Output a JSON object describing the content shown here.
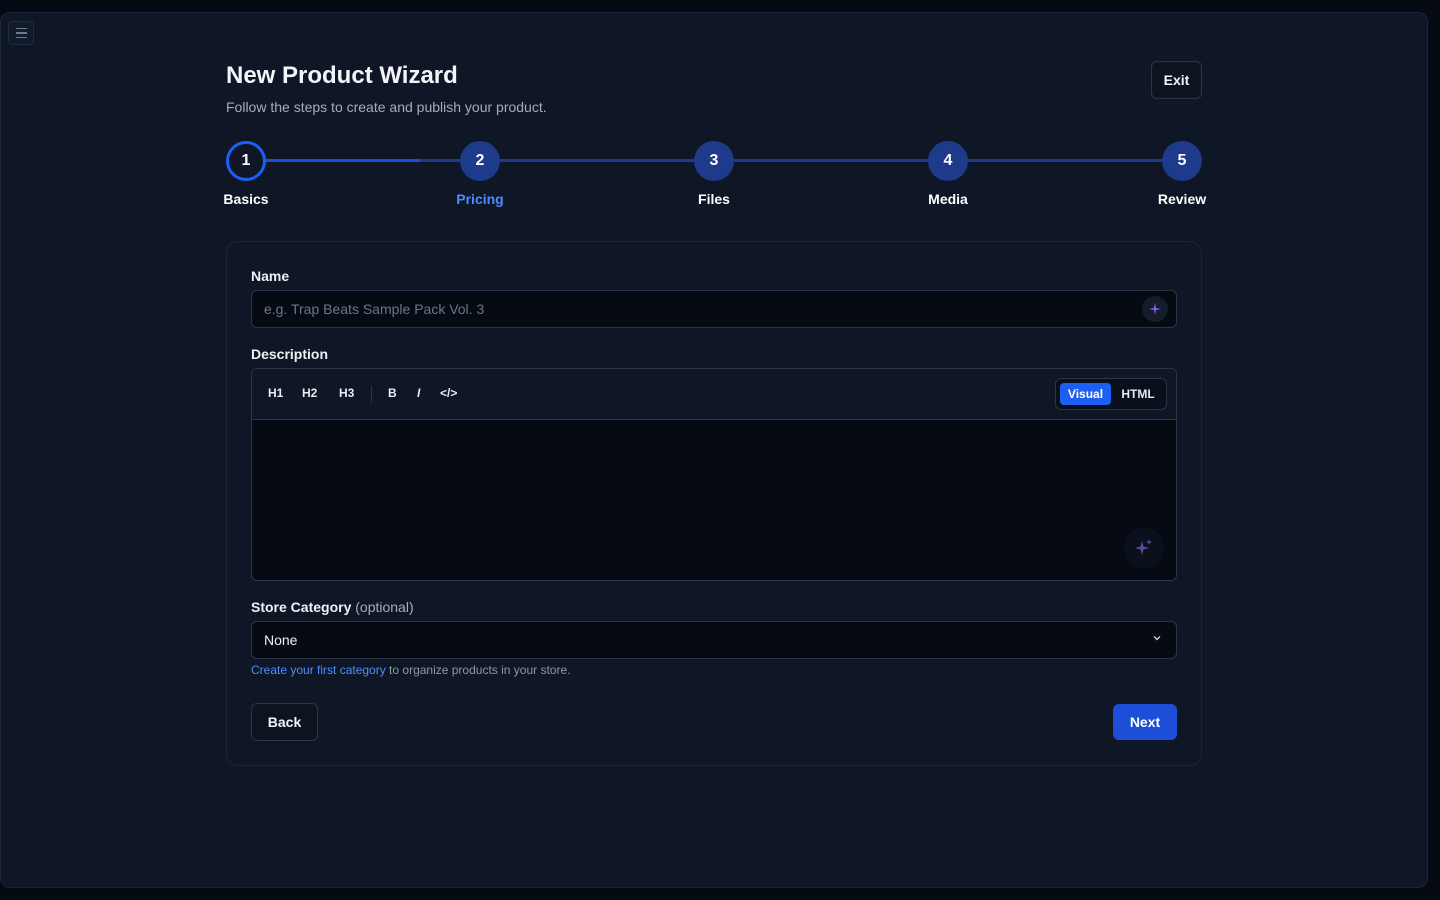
{
  "header": {
    "title": "New Product Wizard",
    "subtitle": "Follow the steps to create and publish your product.",
    "exit_label": "Exit"
  },
  "stepper": {
    "steps": [
      {
        "number": "1",
        "label": "Basics",
        "state": "active"
      },
      {
        "number": "2",
        "label": "Pricing",
        "state": "upcoming"
      },
      {
        "number": "3",
        "label": "Files",
        "state": "upcoming"
      },
      {
        "number": "4",
        "label": "Media",
        "state": "upcoming"
      },
      {
        "number": "5",
        "label": "Review",
        "state": "upcoming"
      }
    ]
  },
  "form": {
    "name_label": "Name",
    "name_placeholder": "e.g. Trap Beats Sample Pack Vol. 3",
    "description_label": "Description",
    "toolbar": {
      "h1": "H1",
      "h2": "H2",
      "h3": "H3",
      "bold": "B",
      "italic": "I",
      "code": "</>",
      "mode_visual": "Visual",
      "mode_html": "HTML",
      "selected_mode": "Visual"
    },
    "category_label": "Store Category",
    "category_optional": "(optional)",
    "category_value": "None",
    "helper_link": "Create your first category",
    "helper_text": " to organize products in your store."
  },
  "actions": {
    "back_label": "Back",
    "next_label": "Next"
  },
  "colors": {
    "accent": "#1d5ff5",
    "background": "#0f1726",
    "link": "#4d8cff"
  },
  "icons": {
    "menu": "menu-icon",
    "ai": "sparkles-icon",
    "dropdown": "chevron-down-icon"
  }
}
